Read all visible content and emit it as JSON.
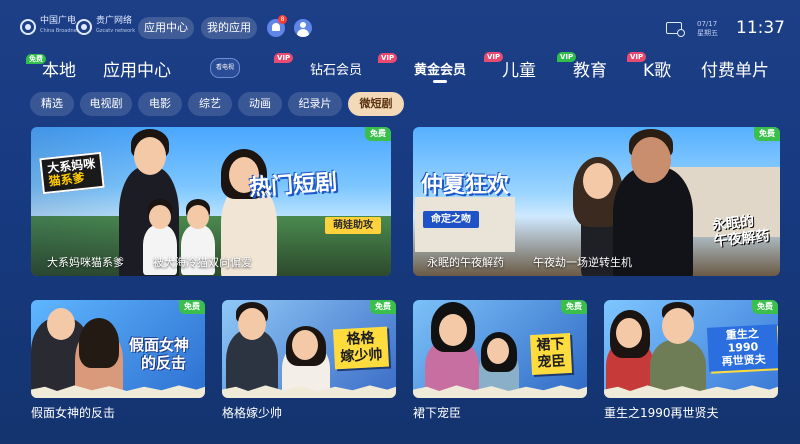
{
  "topbar": {
    "logo1_text": "中国广电",
    "logo1_sub": "China Broadnet",
    "logo2_text": "贵广网络",
    "logo2_sub": "Gzcatv network",
    "app_center_label": "应用中心",
    "my_apps_label": "我的应用",
    "message_badge": "8",
    "date_line1": "07/17",
    "date_line2": "星期五",
    "time": "11:37"
  },
  "nav": {
    "items": [
      {
        "label": "本地",
        "tag": "免费"
      },
      {
        "label": "应用中心",
        "tag": ""
      },
      {
        "label": "钻石会员",
        "tag": "VIP"
      },
      {
        "label": "黄金会员",
        "tag": "VIP"
      },
      {
        "label": "儿童",
        "tag": "VIP"
      },
      {
        "label": "教育",
        "tag": "VIP"
      },
      {
        "label": "K歌",
        "tag": "VIP"
      },
      {
        "label": "付费单片",
        "tag": ""
      }
    ],
    "vip_stack_text": "VIP\n黄金\n会员",
    "tv_logo_text": "看电视"
  },
  "subtabs": [
    "精选",
    "电视剧",
    "电影",
    "综艺",
    "动画",
    "纪录片",
    "微短剧"
  ],
  "free_label": "免费",
  "featured": [
    {
      "caption_left": "大系妈咪猫系爹",
      "caption_right": "被大海冷猫双向偏爱",
      "sticker_line1": "大系妈咪",
      "sticker_line2": "猫系爹",
      "banner_title": "热门短剧",
      "banner_tag": "萌娃助攻"
    },
    {
      "caption_left": "永眠的午夜解药",
      "caption_right": "午夜劫一场逆转生机",
      "banner_title": "仲夏狂欢",
      "banner_tag": "命定之吻",
      "art_title_line1": "永眠的",
      "art_title_line2": "午夜解药"
    }
  ],
  "cards": [
    {
      "title": "假面女神的反击",
      "art_line1": "假面女神",
      "art_line2": "的反击"
    },
    {
      "title": "格格嫁少帅",
      "art_line1": "格格",
      "art_line2": "嫁少帅"
    },
    {
      "title": "裙下宠臣",
      "art_line1": "裙下",
      "art_line2": "宠臣"
    },
    {
      "title": "重生之1990再世贤夫",
      "art_line1": "重生之1990",
      "art_line2": "再世贤夫"
    }
  ],
  "colors": {
    "background": "#1b3c82",
    "free_green": "#3bbf4c",
    "vip_pink": "#e84a72",
    "active_subtab": "#f3d9b7"
  }
}
